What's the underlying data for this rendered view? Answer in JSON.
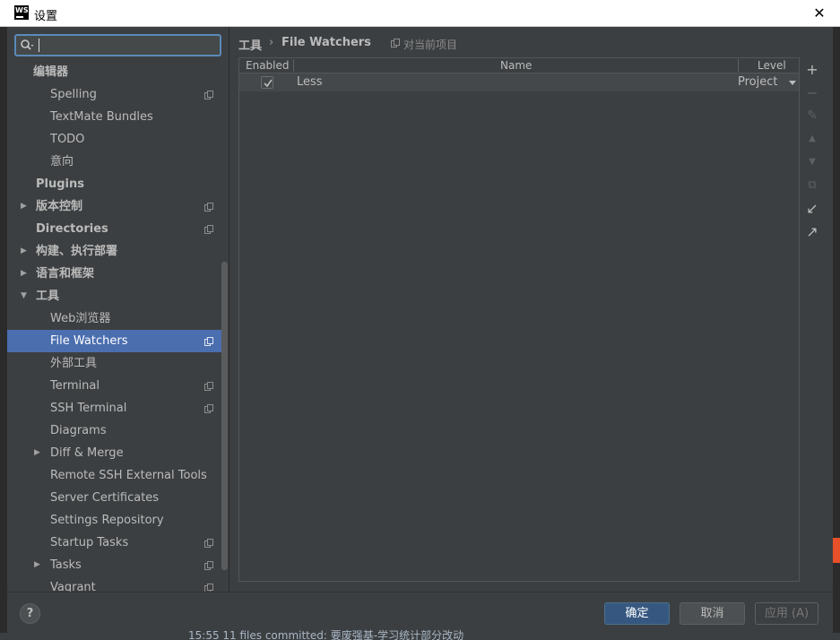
{
  "window": {
    "title": "设置",
    "app_icon_text": "WS",
    "close_glyph": "✕"
  },
  "search": {
    "value": "",
    "placeholder": ""
  },
  "sidebar": {
    "items": [
      {
        "label": "编辑器",
        "level": 0,
        "bold": true
      },
      {
        "label": "Spelling",
        "level": 2,
        "copy": true
      },
      {
        "label": "TextMate Bundles",
        "level": 2
      },
      {
        "label": "TODO",
        "level": 2
      },
      {
        "label": "意向",
        "level": 2
      },
      {
        "label": "Plugins",
        "level": 1,
        "bold": true
      },
      {
        "label": "版本控制",
        "level": 1,
        "bold": true,
        "arrow": "right",
        "copy": true
      },
      {
        "label": "Directories",
        "level": 1,
        "bold": true,
        "copy": true
      },
      {
        "label": "构建、执行部署",
        "level": 1,
        "bold": true,
        "arrow": "right"
      },
      {
        "label": "语言和框架",
        "level": 1,
        "bold": true,
        "arrow": "right"
      },
      {
        "label": "工具",
        "level": 1,
        "bold": true,
        "arrow": "down"
      },
      {
        "label": "Web浏览器",
        "level": 2
      },
      {
        "label": "File Watchers",
        "level": 2,
        "copy": true,
        "selected": true
      },
      {
        "label": "外部工具",
        "level": 2
      },
      {
        "label": "Terminal",
        "level": 2,
        "copy": true
      },
      {
        "label": "SSH Terminal",
        "level": 2,
        "copy": true
      },
      {
        "label": "Diagrams",
        "level": 2
      },
      {
        "label": "Diff & Merge",
        "level": 2,
        "arrow": "right"
      },
      {
        "label": "Remote SSH External Tools",
        "level": 2
      },
      {
        "label": "Server Certificates",
        "level": 2
      },
      {
        "label": "Settings Repository",
        "level": 2
      },
      {
        "label": "Startup Tasks",
        "level": 2,
        "copy": true
      },
      {
        "label": "Tasks",
        "level": 2,
        "arrow": "right",
        "copy": true
      },
      {
        "label": "Vagrant",
        "level": 2,
        "copy": true
      }
    ]
  },
  "breadcrumb": {
    "parent": "工具",
    "separator": "›",
    "current": "File Watchers",
    "scope": "对当前项目"
  },
  "table": {
    "columns": [
      "Enabled",
      "Name",
      "Level"
    ],
    "rows": [
      {
        "enabled": true,
        "name": "Less",
        "level": "Project"
      }
    ]
  },
  "toolbar": {
    "add": "+",
    "remove": "−",
    "edit": "✎",
    "up": "▲",
    "down": "▼",
    "copy": "⧉",
    "import": "↙",
    "export": "↗"
  },
  "footer": {
    "help": "?",
    "ok": "确定",
    "cancel": "取消",
    "apply": "应用 (A)"
  },
  "background": {
    "status_text": "15:55 11 files committed: 要废强基-学习统计部分改动"
  },
  "colors": {
    "accent": "#4b6eaf",
    "primary_button": "#365880",
    "panel": "#3c3f41"
  }
}
